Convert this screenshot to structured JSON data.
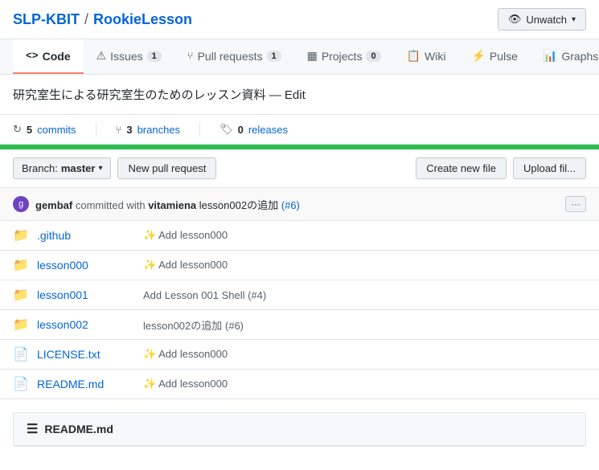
{
  "header": {
    "org": "SLP-KBIT",
    "separator": "/",
    "repo": "RookieLesson",
    "unwatch_label": "Unwatch",
    "unwatch_caret": "▾"
  },
  "nav": {
    "tabs": [
      {
        "id": "code",
        "icon": "<>",
        "label": "Code",
        "badge": null,
        "active": true
      },
      {
        "id": "issues",
        "icon": "!",
        "label": "Issues",
        "badge": "1",
        "active": false
      },
      {
        "id": "pull-requests",
        "icon": "⑂",
        "label": "Pull requests",
        "badge": "1",
        "active": false
      },
      {
        "id": "projects",
        "icon": "▦",
        "label": "Projects",
        "badge": "0",
        "active": false
      },
      {
        "id": "wiki",
        "icon": "≡",
        "label": "Wiki",
        "badge": null,
        "active": false
      },
      {
        "id": "pulse",
        "icon": "⚡",
        "label": "Pulse",
        "badge": null,
        "active": false
      },
      {
        "id": "graphs",
        "icon": "▉",
        "label": "Graphs",
        "badge": null,
        "active": false
      }
    ]
  },
  "description": "研究室生による研究室生のためのレッスン資料 — Edit",
  "stats": {
    "commits": {
      "count": "5",
      "label": "commits",
      "icon": "↻"
    },
    "branches": {
      "count": "3",
      "label": "branches",
      "icon": "⑂"
    },
    "releases": {
      "count": "0",
      "label": "releases",
      "icon": "🏷"
    }
  },
  "branch": {
    "label": "Branch:",
    "name": "master",
    "caret": "▾",
    "new_pr_label": "New pull request",
    "create_file_label": "Create new file",
    "upload_file_label": "Upload fil..."
  },
  "commit": {
    "author": "gembaf",
    "action": "committed with",
    "committer": "vitamiena",
    "message": "lesson002の追加",
    "issue": "(#6)",
    "more": "···",
    "avatar_initial": "g"
  },
  "files": [
    {
      "type": "folder",
      "name": ".github",
      "commit_msg": "✨ Add lesson000",
      "sparkle": true
    },
    {
      "type": "folder",
      "name": "lesson000",
      "commit_msg": "✨ Add lesson000",
      "sparkle": true
    },
    {
      "type": "folder",
      "name": "lesson001",
      "commit_msg": "Add Lesson 001 Shell (#4)",
      "sparkle": false
    },
    {
      "type": "folder",
      "name": "lesson002",
      "commit_msg": "lesson002の追加 (#6)",
      "sparkle": false
    },
    {
      "type": "file",
      "name": "LICENSE.txt",
      "commit_msg": "✨ Add lesson000",
      "sparkle": true
    },
    {
      "type": "file",
      "name": "README.md",
      "commit_msg": "✨ Add lesson000",
      "sparkle": true
    }
  ],
  "readme": {
    "icon": "≡",
    "title": "README.md"
  }
}
